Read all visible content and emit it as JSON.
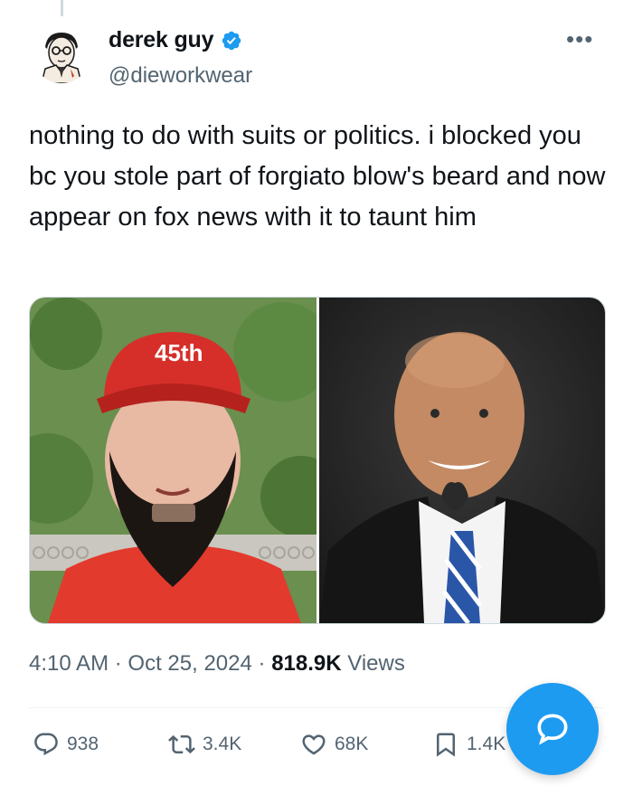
{
  "author": {
    "name": "derek guy",
    "handle": "@dieworkwear",
    "verified": true,
    "avatar_icon": "illustrated-man-with-glasses-avatar"
  },
  "tweet": {
    "text": "nothing to do with suits or politics. i blocked you bc you stole part of forgiato blow's beard and now appear on fox news with it to taunt him",
    "media": [
      {
        "icon": "photo-man-red-45th-cap-long-beard",
        "cap_text": "45th"
      },
      {
        "icon": "photo-bald-man-suit-goatee"
      }
    ]
  },
  "meta": {
    "time": "4:10 AM",
    "separator": "·",
    "date": "Oct 25, 2024",
    "views_count": "818.9K",
    "views_label": "Views"
  },
  "actions": {
    "replies": "938",
    "reposts": "3.4K",
    "likes": "68K",
    "bookmarks": "1.4K"
  },
  "colors": {
    "accent": "#1d9bf0",
    "secondary_text": "#536471",
    "primary_text": "#0f1419"
  }
}
